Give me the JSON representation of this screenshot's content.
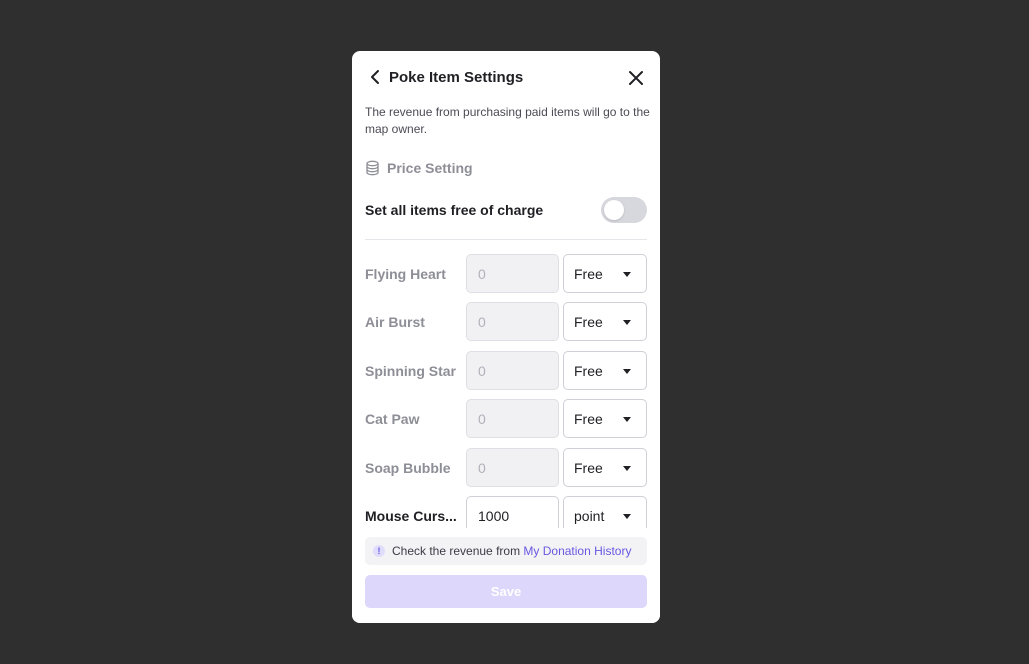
{
  "modal": {
    "title": "Poke Item Settings",
    "description": "The revenue from purchasing paid items will go to the map owner.",
    "back_icon": "chevron-left-icon",
    "close_icon": "close-icon"
  },
  "price_setting": {
    "section_label": "Price Setting",
    "section_icon": "coins-stack-icon",
    "free_toggle_label": "Set all items free of charge",
    "free_toggle_on": false
  },
  "items": [
    {
      "name": "Flying Heart",
      "price": "0",
      "currency": "Free",
      "enabled": false
    },
    {
      "name": "Air Burst",
      "price": "0",
      "currency": "Free",
      "enabled": false
    },
    {
      "name": "Spinning Star",
      "price": "0",
      "currency": "Free",
      "enabled": false
    },
    {
      "name": "Cat Paw",
      "price": "0",
      "currency": "Free",
      "enabled": false
    },
    {
      "name": "Soap Bubble",
      "price": "0",
      "currency": "Free",
      "enabled": false
    },
    {
      "name": "Mouse Curs...",
      "price": "1000",
      "currency": "point",
      "enabled": true
    }
  ],
  "footer": {
    "notice_icon_glyph": "!",
    "notice_text": "Check the revenue from ",
    "notice_link": "My Donation History",
    "save_label": "Save",
    "save_disabled": true
  },
  "colors": {
    "backdrop": "#2f2f30",
    "accent": "#6758e0",
    "save_disabled_bg": "#dcd7fb"
  }
}
